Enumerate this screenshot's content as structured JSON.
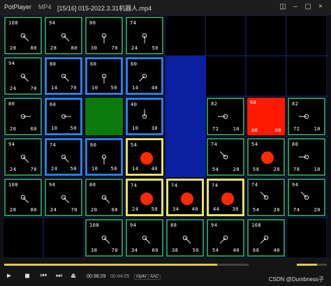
{
  "titlebar": {
    "app_name": "PotPlayer",
    "format": "MP4",
    "file_title": "[15/16] 015-2022.3.31机器人.mp4",
    "buttons": [
      "pin-icon",
      "minimize-icon",
      "maximize-icon",
      "close-icon"
    ]
  },
  "grid_cells": [
    {
      "id": "r0c0",
      "tl": "108",
      "bl": "28",
      "br": "80",
      "angle": 135,
      "style": "green"
    },
    {
      "id": "r0c1",
      "tl": "94",
      "bl": "28",
      "br": "80",
      "angle": 135,
      "style": "green"
    },
    {
      "id": "r0c2",
      "tl": "80",
      "bl": "30",
      "br": "70",
      "angle": 180,
      "style": "green"
    },
    {
      "id": "r0c3",
      "tl": "74",
      "bl": "24",
      "br": "50",
      "angle": 180,
      "style": "green"
    },
    {
      "id": "r1c0",
      "tl": "94",
      "bl": "24",
      "br": "70",
      "angle": 135,
      "style": "green"
    },
    {
      "id": "r1c1",
      "tl": "80",
      "bl": "14",
      "br": "70",
      "angle": 135,
      "style": "blue"
    },
    {
      "id": "r1c2",
      "tl": "60",
      "bl": "10",
      "br": "50",
      "angle": 180,
      "style": "blue"
    },
    {
      "id": "r1c3",
      "tl": "60",
      "bl": "14",
      "br": "40",
      "angle": 225,
      "style": "blue"
    },
    {
      "id": "r2c0",
      "tl": "80",
      "bl": "20",
      "br": "60",
      "angle": 90,
      "style": "green"
    },
    {
      "id": "r2c1",
      "tl": "60",
      "bl": "10",
      "br": "50",
      "angle": 90,
      "style": "blue"
    },
    {
      "id": "r2c3",
      "tl": "40",
      "bl": "10",
      "br": "30",
      "angle": 0,
      "style": "blue"
    },
    {
      "id": "r2c5",
      "tl": "82",
      "bl": "72",
      "br": "10",
      "angle": 270,
      "style": "green"
    },
    {
      "id": "r2c6",
      "tl": "68",
      "bl": "68",
      "br": "00",
      "angle": null,
      "style": "red"
    },
    {
      "id": "r2c7",
      "tl": "82",
      "bl": "72",
      "br": "10",
      "angle": 270,
      "style": "green"
    },
    {
      "id": "r3c0",
      "tl": "94",
      "bl": "24",
      "br": "70",
      "angle": 135,
      "style": "green"
    },
    {
      "id": "r3c1",
      "tl": "74",
      "bl": "24",
      "br": "50",
      "angle": 135,
      "style": "blue"
    },
    {
      "id": "r3c2",
      "tl": "60",
      "bl": "10",
      "br": "50",
      "angle": 180,
      "style": "blue"
    },
    {
      "id": "r3c3",
      "tl": "54",
      "bl": "14",
      "br": "40",
      "angle": null,
      "dot": true,
      "style": "yellow"
    },
    {
      "id": "r3c5",
      "tl": "74",
      "bl": "54",
      "br": "20",
      "angle": 315,
      "style": "green"
    },
    {
      "id": "r3c6",
      "tl": "54",
      "bl": "58",
      "br": "20",
      "angle": null,
      "dot": true,
      "style": "green"
    },
    {
      "id": "r3c7",
      "tl": "88",
      "bl": "78",
      "br": "10",
      "angle": 270,
      "style": "green"
    },
    {
      "id": "r4c0",
      "tl": "108",
      "bl": "28",
      "br": "80",
      "angle": 135,
      "style": "green"
    },
    {
      "id": "r4c1",
      "tl": "94",
      "bl": "24",
      "br": "70",
      "angle": 135,
      "style": "green"
    },
    {
      "id": "r4c2",
      "tl": "80",
      "bl": "20",
      "br": "60",
      "angle": 135,
      "style": "green"
    },
    {
      "id": "r4c3",
      "tl": "74",
      "bl": "24",
      "br": "50",
      "angle": null,
      "dot": true,
      "style": "yellow"
    },
    {
      "id": "r4c4",
      "tl": "74",
      "bl": "34",
      "br": "40",
      "angle": null,
      "dot": true,
      "style": "yellow"
    },
    {
      "id": "r4c5",
      "tl": "74",
      "bl": "44",
      "br": "30",
      "angle": null,
      "dot": true,
      "style": "yellow"
    },
    {
      "id": "r4c6",
      "tl": "74",
      "bl": "54",
      "br": "20",
      "angle": 315,
      "style": "green"
    },
    {
      "id": "r4c7",
      "tl": "94",
      "bl": "74",
      "br": "20",
      "angle": 315,
      "style": "green"
    },
    {
      "id": "r5c2",
      "tl": "108",
      "bl": "38",
      "br": "70",
      "angle": 135,
      "style": "green"
    },
    {
      "id": "r5c3",
      "tl": "94",
      "bl": "34",
      "br": "60",
      "angle": 135,
      "style": "green"
    },
    {
      "id": "r5c4",
      "tl": "88",
      "bl": "38",
      "br": "50",
      "angle": 135,
      "style": "green"
    },
    {
      "id": "r5c5",
      "tl": "94",
      "bl": "54",
      "br": "40",
      "angle": 225,
      "style": "green"
    },
    {
      "id": "r5c6",
      "tl": "108",
      "bl": "68",
      "br": "40",
      "angle": 225,
      "style": "green"
    }
  ],
  "special_cells": [
    {
      "id": "start",
      "kind": "green-block"
    },
    {
      "id": "wall",
      "kind": "blue-block"
    }
  ],
  "controls": {
    "current_time": "00:38:29",
    "total_time": "00:44:05",
    "tag_video": "mp4v",
    "tag_audio": "AAC",
    "progress": 0.87,
    "volume": 0.68,
    "watermark": "CSDN @Dumbness子"
  },
  "colors": {
    "accent": "#e4c940",
    "green_border": "#2f8f55",
    "blue_border": "#2f7fe0",
    "yellow_border": "#e8e26a",
    "red": "#ff1a00"
  }
}
